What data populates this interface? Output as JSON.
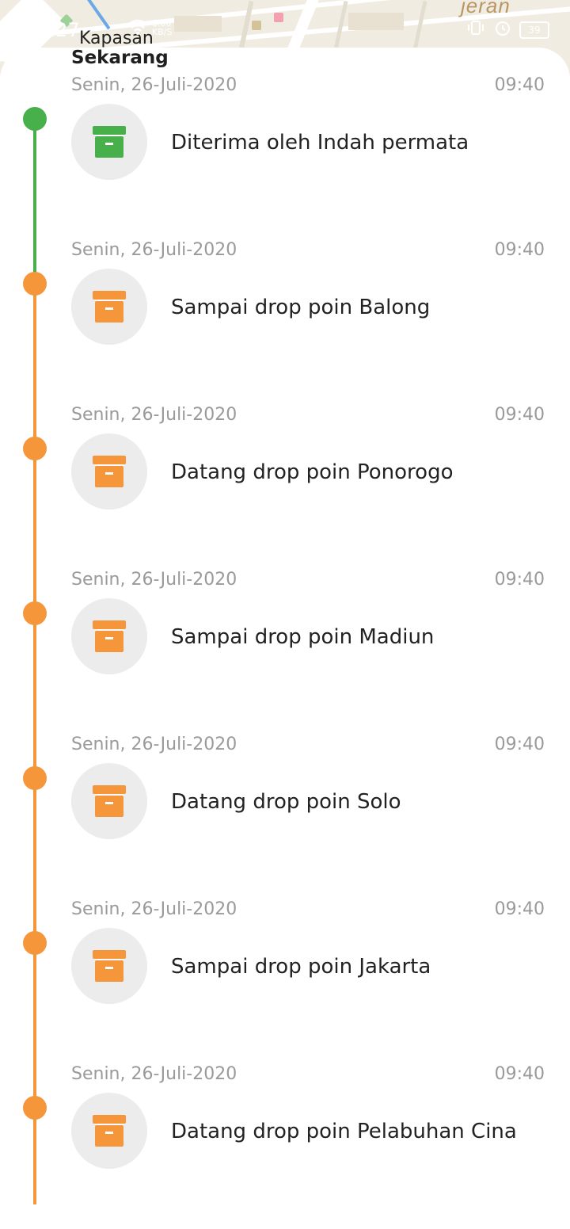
{
  "status_bar": {
    "time": "13.27",
    "speed_value": "1.00",
    "speed_unit": "KB/S",
    "battery": "39"
  },
  "map": {
    "place_label": "Kapasan",
    "corner_label": "jeran"
  },
  "sheet": {
    "title": "Sekarang"
  },
  "colors": {
    "green": "#47b04b",
    "orange": "#f5963a",
    "icon_bg": "#ececec"
  },
  "timeline": [
    {
      "date": "Senin, 26-Juli-2020",
      "time": "09:40",
      "label": "Diterima oleh Indah permata",
      "status": "delivered",
      "icon": "archive-box-icon"
    },
    {
      "date": "Senin, 26-Juli-2020",
      "time": "09:40",
      "label": "Sampai drop poin Balong",
      "status": "transit",
      "icon": "archive-box-icon"
    },
    {
      "date": "Senin, 26-Juli-2020",
      "time": "09:40",
      "label": "Datang drop poin Ponorogo",
      "status": "transit",
      "icon": "archive-box-icon"
    },
    {
      "date": "Senin, 26-Juli-2020",
      "time": "09:40",
      "label": "Sampai drop poin Madiun",
      "status": "transit",
      "icon": "archive-box-icon"
    },
    {
      "date": "Senin, 26-Juli-2020",
      "time": "09:40",
      "label": "Datang drop poin Solo",
      "status": "transit",
      "icon": "archive-box-icon"
    },
    {
      "date": "Senin, 26-Juli-2020",
      "time": "09:40",
      "label": "Sampai drop poin Jakarta",
      "status": "transit",
      "icon": "archive-box-icon"
    },
    {
      "date": "Senin, 26-Juli-2020",
      "time": "09:40",
      "label": "Datang drop poin Pelabuhan Cina",
      "status": "transit",
      "icon": "archive-box-icon"
    }
  ]
}
